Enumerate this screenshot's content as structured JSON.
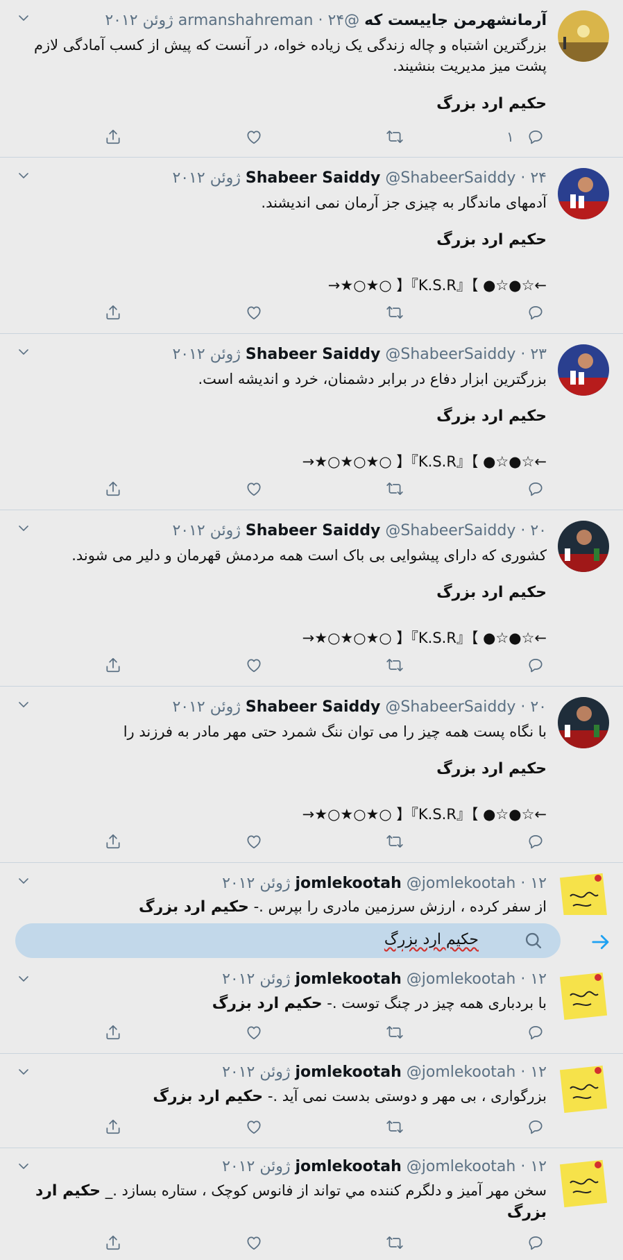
{
  "tweets": [
    {
      "name": "آرمانشهرمن جاییست که",
      "handle": "@armanshahreman",
      "date": "۲۴ ژوئن ۲۰۱۲",
      "text": "بزرگترین اشتباه و چاله زندگی یک زیاده خواه، در آنست که پیش از کسب آمادگی لازم پشت میز مدیریت بنشیند.",
      "bold": "حکیم ارد بزرگ",
      "reply_count": "۱"
    },
    {
      "name": "Shabeer Saiddy",
      "handle": "@ShabeerSaiddy",
      "date": "۲۴ ژوئن ۲۰۱۲",
      "text": "آدمهای ماندگار به چیزی جز آرمان نمی اندیشند.",
      "bold": "حکیم ارد بزرگ",
      "extra": "←☆●☆● 】『K.S.R』【 ○★○★→"
    },
    {
      "name": "Shabeer Saiddy",
      "handle": "@ShabeerSaiddy",
      "date": "۲۳ ژوئن ۲۰۱۲",
      "text": "بزرگترین ابزار دفاع در برابر دشمنان، خرد و اندیشه است.",
      "bold": "حکیم ارد بزرگ",
      "extra": "←☆●☆● 】『K.S.R』【 ○★○★○★→"
    },
    {
      "name": "Shabeer Saiddy",
      "handle": "@ShabeerSaiddy",
      "date": "۲۰ ژوئن ۲۰۱۲",
      "text": "کشوری که دارای پیشوایی بی باک است همه مردمش قهرمان و دلیر می شوند.",
      "bold": "حکیم ارد بزرگ",
      "extra": "←☆●☆● 】『K.S.R』【 ○★○★○★→"
    },
    {
      "name": "Shabeer Saiddy",
      "handle": "@ShabeerSaiddy",
      "date": "۲۰ ژوئن ۲۰۱۲",
      "text": "با نگاه پست همه چیز را می توان ننگ شمرد حتی مهر مادر به فرزند را",
      "bold": "حکیم ارد بزرگ",
      "extra": "←☆●☆● 】『K.S.R』【 ○★○★○★→"
    },
    {
      "name": "jomlekootah",
      "handle": "@jomlekootah",
      "date": "۱۲ ژوئن ۲۰۱۲",
      "text": "از سفر کرده ، ارزش سرزمین مادری را بپرس .-",
      "bold": "حکیم ارد بزرگ"
    },
    {
      "name": "jomlekootah",
      "handle": "@jomlekootah",
      "date": "۱۲ ژوئن ۲۰۱۲",
      "text": "با بردباری همه چیز در چنگ توست .-",
      "bold": "حکیم ارد بزرگ"
    },
    {
      "name": "jomlekootah",
      "handle": "@jomlekootah",
      "date": "۱۲ ژوئن ۲۰۱۲",
      "text": "بزرگواری ، بی مهر و دوستی بدست نمی آید .-",
      "bold": "حکیم ارد بزرگ"
    },
    {
      "name": "jomlekootah",
      "handle": "@jomlekootah",
      "date": "۱۲ ژوئن ۲۰۱۲",
      "text": "سخن مهر آميز و دلگرم كننده مي تواند از فانوس كوچک ، ستاره بسازد ._",
      "bold": "حکیم ارد بزرگ"
    }
  ],
  "search": {
    "query": "حکیم ارد بزرگ"
  },
  "colors": {
    "accent": "#1da1f2",
    "meta": "#5b7083",
    "search_bg": "#c2d8ea",
    "background": "#ebebeb"
  },
  "icons": {
    "reply": "reply-icon",
    "retweet": "retweet-icon",
    "like": "like-icon",
    "share": "share-icon",
    "search": "search-icon",
    "go": "arrow-right-icon",
    "menu": "chevron-down-icon"
  }
}
